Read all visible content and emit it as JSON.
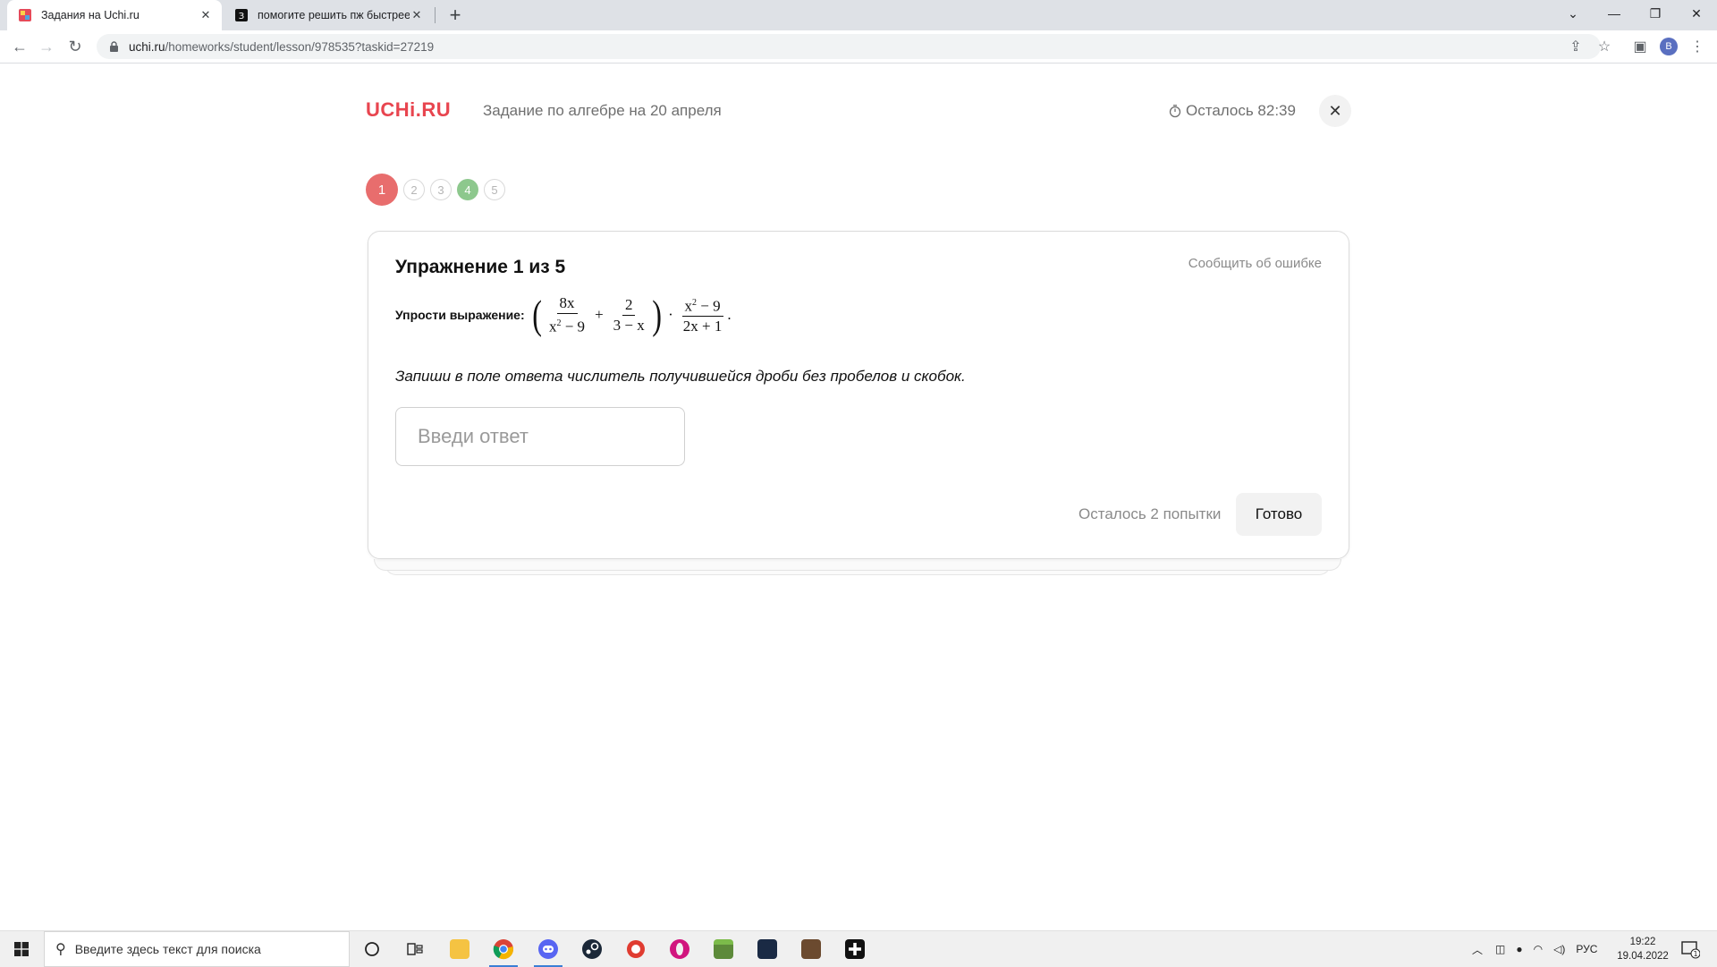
{
  "browser": {
    "tabs": [
      {
        "title": "Задания на Uchi.ru",
        "active": true
      },
      {
        "title": "помогите решить пж быстрее!!!",
        "active": false
      }
    ],
    "url_host": "uchi.ru",
    "url_path": "/homeworks/student/lesson/978535?taskid=27219",
    "profile_initial": "B"
  },
  "header": {
    "logo": "UCHi.RU",
    "homework_title": "Задание по алгебре на 20 апреля",
    "timer": "Осталось 82:39"
  },
  "steps": [
    {
      "label": "1",
      "state": "current"
    },
    {
      "label": "2",
      "state": "pending"
    },
    {
      "label": "3",
      "state": "pending"
    },
    {
      "label": "4",
      "state": "done"
    },
    {
      "label": "5",
      "state": "pending"
    }
  ],
  "exercise": {
    "title": "Упражнение 1 из 5",
    "report_link": "Сообщить об ошибке",
    "task_label": "Упрости выражение:",
    "expression": {
      "frac1_num": "8x",
      "frac1_den_base": "x",
      "frac1_den_exp": "2",
      "frac1_den_rest": " − 9",
      "plus": "+",
      "frac2_num": "2",
      "frac2_den": "3 − x",
      "dot": "·",
      "frac3_num_base": "x",
      "frac3_num_exp": "2",
      "frac3_num_rest": " − 9",
      "frac3_den": "2x + 1",
      "end": "."
    },
    "instruction": "Запиши в поле ответа числитель получившейся дроби без пробелов и скобок.",
    "answer_placeholder": "Введи ответ",
    "answer_value": "",
    "attempts_left": "Осталось 2 попытки",
    "submit_label": "Готово"
  },
  "taskbar": {
    "search_placeholder": "Введите здесь текст для поиска",
    "language": "РУС",
    "time": "19:22",
    "date": "19.04.2022",
    "notification_count": "1"
  },
  "colors": {
    "brand": "#e8454f",
    "step_current": "#e86d6d",
    "step_done": "#8dc88d"
  }
}
